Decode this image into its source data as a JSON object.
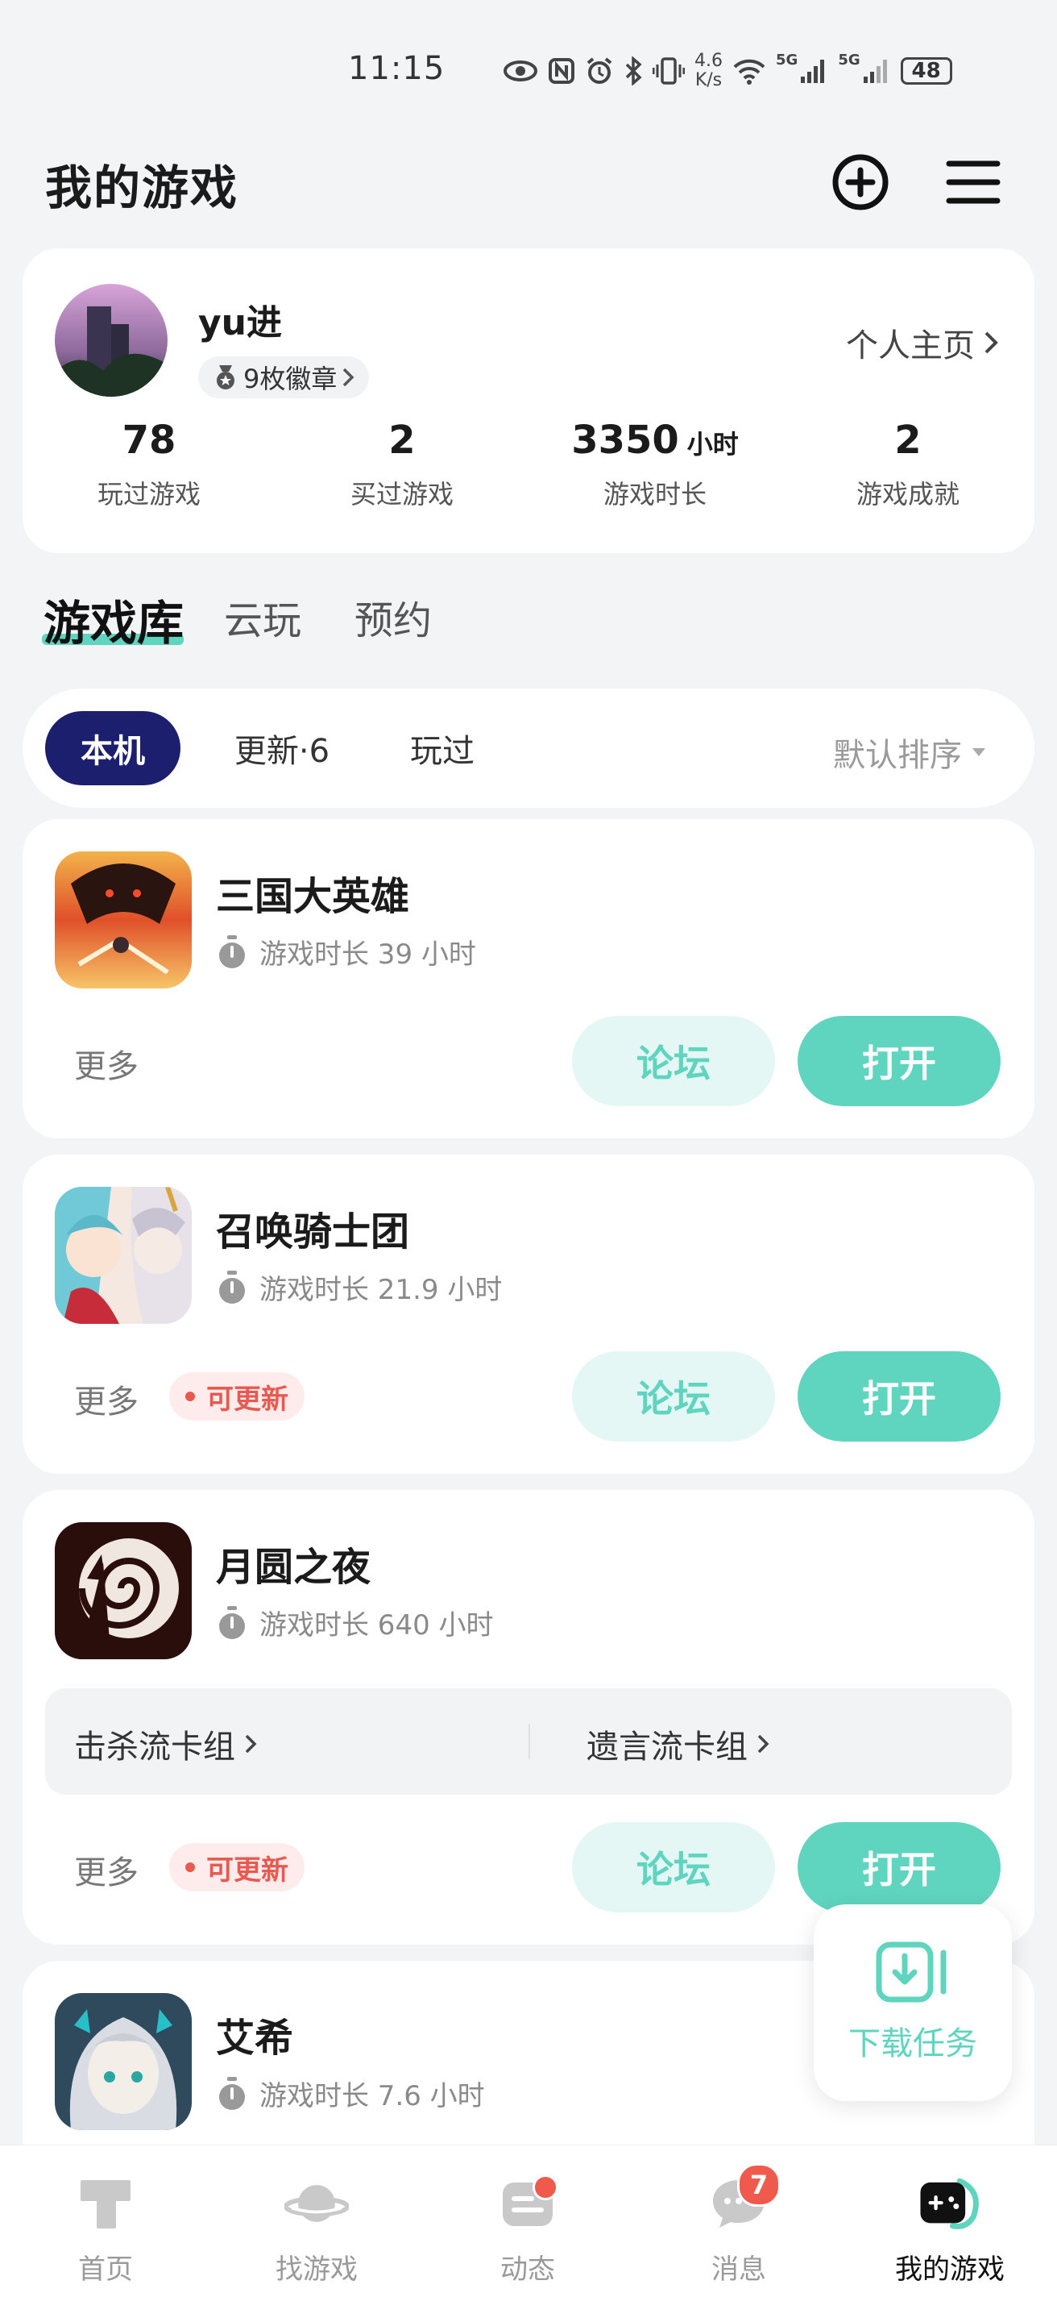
{
  "status_bar": {
    "time": "11:15",
    "net_speed_value": "4.6",
    "net_speed_unit": "K/s",
    "signal_1": "5G",
    "signal_2": "5G",
    "battery": "48"
  },
  "header": {
    "title": "我的游戏",
    "icons": [
      "add-circle-icon",
      "menu-icon"
    ]
  },
  "profile": {
    "username": "yu进",
    "badges": "9枚徽章",
    "homepage_link": "个人主页",
    "stats": [
      {
        "value": "78",
        "unit": "",
        "label": "玩过游戏"
      },
      {
        "value": "2",
        "unit": "",
        "label": "买过游戏"
      },
      {
        "value": "3350",
        "unit": "小时",
        "label": "游戏时长"
      },
      {
        "value": "2",
        "unit": "",
        "label": "游戏成就"
      }
    ]
  },
  "tabs": [
    "游戏库",
    "云玩",
    "预约"
  ],
  "filters": {
    "chips": [
      "本机",
      "更新·6",
      "玩过"
    ],
    "active": "本机",
    "sort": "默认排序"
  },
  "games": [
    {
      "name": "三国大英雄",
      "playtime": "游戏时长 39 小时",
      "more": "更多",
      "update": "",
      "forum": "论坛",
      "open": "打开"
    },
    {
      "name": "召唤骑士团",
      "playtime": "游戏时长 21.9 小时",
      "more": "更多",
      "update": "可更新",
      "forum": "论坛",
      "open": "打开"
    },
    {
      "name": "月圆之夜",
      "playtime": "游戏时长 640 小时",
      "more": "更多",
      "update": "可更新",
      "forum": "论坛",
      "open": "打开",
      "decks": [
        "击杀流卡组",
        "遗言流卡组"
      ]
    },
    {
      "name": "艾希",
      "playtime": "游戏时长 7.6 小时"
    }
  ],
  "download_fab": {
    "label": "下载任务"
  },
  "bottom_nav": [
    {
      "label": "首页",
      "icon": "home-t-icon"
    },
    {
      "label": "找游戏",
      "icon": "planet-icon"
    },
    {
      "label": "动态",
      "icon": "feed-icon",
      "dot": true
    },
    {
      "label": "消息",
      "icon": "chat-icon",
      "count": "7"
    },
    {
      "label": "我的游戏",
      "icon": "gamepad-icon",
      "active": true
    }
  ],
  "colors": {
    "accent": "#5fd4bf",
    "chip_active": "#1c1f6e",
    "update_red": "#e85a4f",
    "badge_red": "#ef5a4c"
  }
}
